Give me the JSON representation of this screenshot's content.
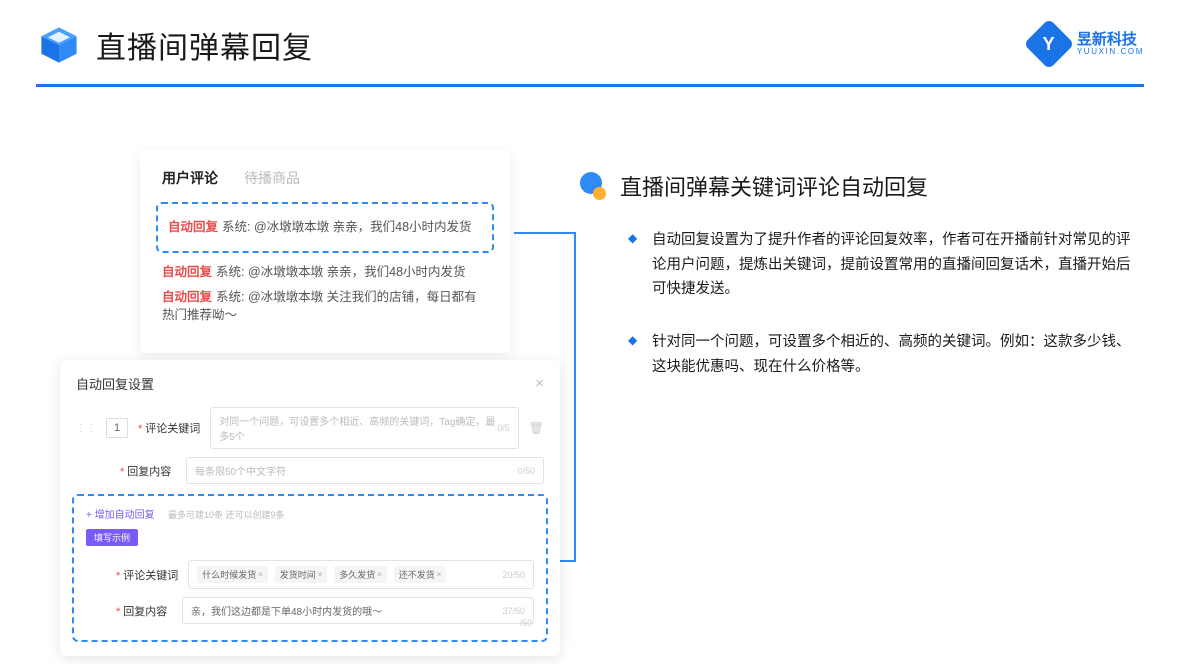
{
  "header": {
    "title": "直播间弹幕回复"
  },
  "brand": {
    "name": "昱新科技",
    "sub": "YUUXIN.COM",
    "glyph": "Y"
  },
  "right": {
    "title": "直播间弹幕关键词评论自动回复",
    "bullets": [
      "自动回复设置为了提升作者的评论回复效率，作者可在开播前针对常见的评论用户问题，提炼出关键词，提前设置常用的直播间回复话术，直播开始后可快捷发送。",
      "针对同一个问题，可设置多个相近的、高频的关键词。例如：这款多少钱、这块能优惠吗、现在什么价格等。"
    ]
  },
  "comments": {
    "tabs": {
      "active": "用户评论",
      "inactive": "待播商品"
    },
    "badge": "自动回复",
    "items": [
      "系统: @冰墩墩本墩 亲亲，我们48小时内发货",
      "系统: @冰墩墩本墩 亲亲，我们48小时内发货",
      "系统: @冰墩墩本墩 关注我们的店铺，每日都有热门推荐呦～"
    ]
  },
  "settings": {
    "title": "自动回复设置",
    "close": "×",
    "num": "1",
    "label_keyword": "评论关键词",
    "placeholder_keyword": "对同一个问题，可设置多个相近、高频的关键词，Tag确定，最多5个",
    "count_keyword": "0/5",
    "label_content": "回复内容",
    "placeholder_content": "每条限50个中文字符",
    "count_content": "0/50",
    "add_link": "+ 增加自动回复",
    "add_hint": "最多可建10条 还可以创建9条",
    "example_label": "填写示例",
    "example_tags": [
      "什么时候发货",
      "发货时间",
      "多久发货",
      "还不发货"
    ],
    "example_count_kw": "20/50",
    "example_content": "亲，我们这边都是下单48小时内发货的哦～",
    "example_count_ct": "37/50",
    "ghost_count": "/50"
  }
}
